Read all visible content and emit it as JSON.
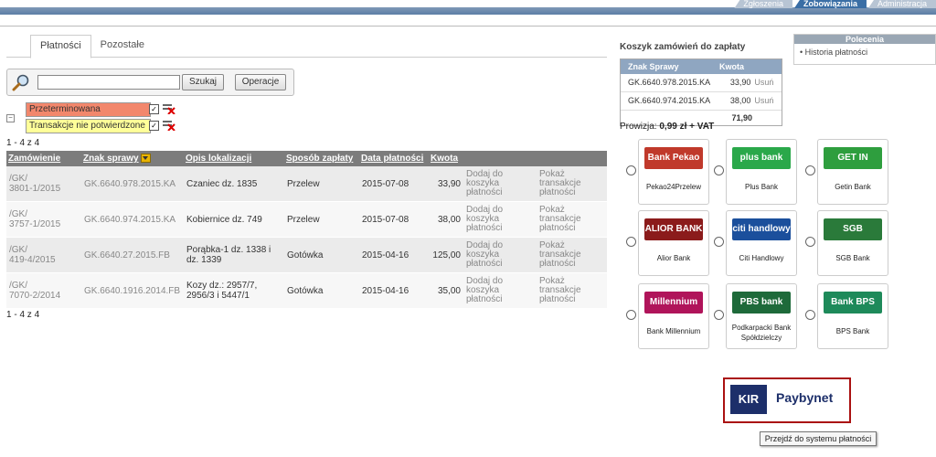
{
  "top_nav": [
    "Zgłoszenia",
    "Zobowiązania",
    "Administracja"
  ],
  "tabs": [
    "Płatności",
    "Pozostałe"
  ],
  "search": {
    "value": "",
    "search_label": "Szukaj",
    "operations_label": "Operacje"
  },
  "legend": [
    {
      "label": "Przeterminowana",
      "color": "#f2876c",
      "checked": true
    },
    {
      "label": "Transakcje nie potwierdzone",
      "color": "#ffff99",
      "checked": true
    }
  ],
  "count_top": "1 - 4 z 4",
  "count_bottom": "1 - 4 z 4",
  "table": {
    "headers": [
      "Zamówienie",
      "Znak sprawy",
      "Opis lokalizacji",
      "Sposób zapłaty",
      "Data płatności",
      "Kwota",
      "",
      ""
    ],
    "rows": [
      {
        "order": "/GK/\n3801-1/2015",
        "case": "GK.6640.978.2015.KA",
        "location": "Czaniec dz. 1835",
        "method": "Przelew",
        "date": "2015-07-08",
        "amount": "33,90",
        "add": "Dodaj do koszyka płatności",
        "show": "Pokaż transakcje płatności"
      },
      {
        "order": "/GK/\n3757-1/2015",
        "case": "GK.6640.974.2015.KA",
        "location": "Kobiernice dz. 749",
        "method": "Przelew",
        "date": "2015-07-08",
        "amount": "38,00",
        "add": "Dodaj do koszyka płatności",
        "show": "Pokaż transakcje płatności"
      },
      {
        "order": "/GK/\n419-4/2015",
        "case": "GK.6640.27.2015.FB",
        "location": "Porąbka-1 dz. 1338 i dz. 1339",
        "method": "Gotówka",
        "date": "2015-04-16",
        "amount": "125,00",
        "add": "Dodaj do koszyka płatności",
        "show": "Pokaż transakcje płatności"
      },
      {
        "order": "/GK/\n7070-2/2014",
        "case": "GK.6640.1916.2014.FB",
        "location": "Kozy dz.: 2957/7, 2956/3 i 5447/1",
        "method": "Gotówka",
        "date": "2015-04-16",
        "amount": "35,00",
        "add": "Dodaj do koszyka płatności",
        "show": "Pokaż transakcje płatności"
      }
    ]
  },
  "cart": {
    "title": "Koszyk zamówień do zapłaty",
    "headers": [
      "Znak Sprawy",
      "Kwota"
    ],
    "rows": [
      {
        "case": "GK.6640.978.2015.KA",
        "amount": "33,90",
        "remove": "Usuń"
      },
      {
        "case": "GK.6640.974.2015.KA",
        "amount": "38,00",
        "remove": "Usuń"
      }
    ],
    "total": "71,90",
    "fee_label": "Prowizja:",
    "fee_value": "0,99 zł + VAT"
  },
  "recommend": {
    "title": "Polecenia",
    "item": "Historia płatności"
  },
  "banks": [
    {
      "name": "Pekao24Przelew",
      "logo_text": "Bank Pekao",
      "color": "#c0392b"
    },
    {
      "name": "Plus Bank",
      "logo_text": "plus bank",
      "color": "#2aa84a"
    },
    {
      "name": "Getin Bank",
      "logo_text": "GET IN BANK",
      "color": "#2e9e3e"
    },
    {
      "name": "Alior Bank",
      "logo_text": "ALIOR BANK",
      "color": "#8b1b1b"
    },
    {
      "name": "Citi Handlowy",
      "logo_text": "citi handlowy",
      "color": "#1b4f9c"
    },
    {
      "name": "SGB Bank",
      "logo_text": "SGB",
      "color": "#2a7a3a"
    },
    {
      "name": "Bank Millennium",
      "logo_text": "Millennium",
      "color": "#b0145a"
    },
    {
      "name": "Podkarpacki Bank\nSpółdzielczy",
      "logo_text": "PBS bank",
      "color": "#1e6a3a"
    },
    {
      "name": "BPS Bank",
      "logo_text": "Bank BPS",
      "color": "#1e8a5a"
    }
  ],
  "paybynet": {
    "kir": "KIR",
    "label": "Paybynet",
    "tooltip": "Przejdź do systemu płatności"
  },
  "accent": "#3a6ea5"
}
